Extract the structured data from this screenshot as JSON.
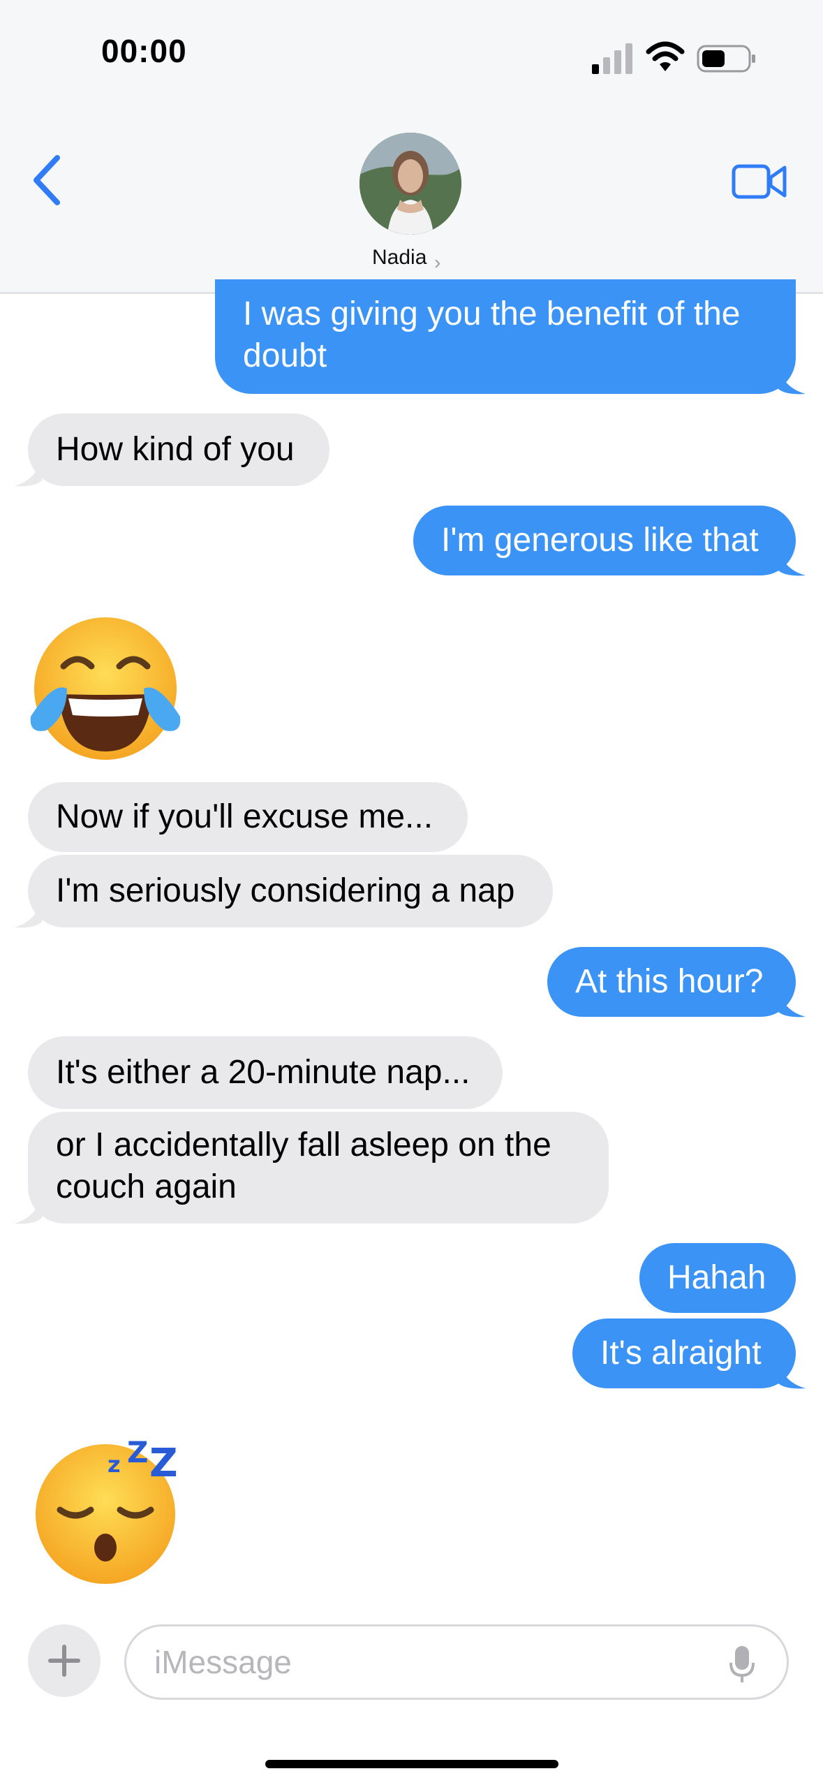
{
  "status_bar": {
    "time": "00:00"
  },
  "header": {
    "contact_name": "Nadia",
    "chevron": "›"
  },
  "messages": [
    {
      "from": "me",
      "text": "I was giving you the benefit of the doubt"
    },
    {
      "from": "them",
      "text": "How kind of you"
    },
    {
      "from": "me",
      "text": "I'm generous like that"
    },
    {
      "from": "them",
      "emoji": "face-with-tears-of-joy"
    },
    {
      "from": "them",
      "text": "Now if you'll excuse me..."
    },
    {
      "from": "them",
      "text": "I'm seriously considering a nap"
    },
    {
      "from": "me",
      "text": "At this hour?"
    },
    {
      "from": "them",
      "text": "It's either a 20-minute nap..."
    },
    {
      "from": "them",
      "text": "or I accidentally fall asleep on the couch again"
    },
    {
      "from": "me",
      "text": "Hahah"
    },
    {
      "from": "me",
      "text": "It's alraight"
    },
    {
      "from": "them",
      "emoji": "sleeping-face"
    }
  ],
  "input": {
    "placeholder": "iMessage"
  },
  "colors": {
    "outgoing": "#3b93f5",
    "incoming": "#e9e9eb",
    "accent": "#2f7cf6"
  }
}
